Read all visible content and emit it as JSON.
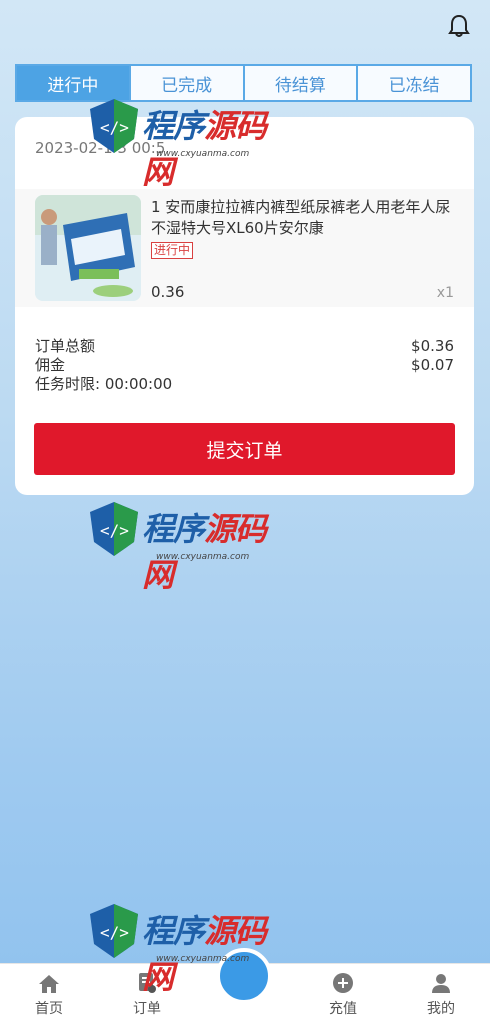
{
  "tabs": [
    {
      "label": "进行中"
    },
    {
      "label": "已完成"
    },
    {
      "label": "待结算"
    },
    {
      "label": "已冻结"
    }
  ],
  "order": {
    "time": "2023-02-1 3 00:5",
    "product_title": "1 安而康拉拉裤内裤型纸尿裤老人用老年人尿不湿特大号XL60片安尔康",
    "status": "进行中",
    "price": "0.36",
    "quantity": "x1"
  },
  "summary": {
    "total_label": "订单总额",
    "total_value": "$0.36",
    "commission_label": "佣金",
    "commission_value": "$0.07",
    "time_limit_label": "任务时限: 00:00:00"
  },
  "submit_label": "提交订单",
  "watermark": {
    "text_blue": "程序",
    "text_red": "源码网",
    "url": "www.cxyuanma.com"
  },
  "nav": [
    {
      "label": "首页",
      "icon": "home-icon"
    },
    {
      "label": "订单",
      "icon": "order-icon"
    },
    {
      "label": "充值",
      "icon": "plus-circle-icon"
    },
    {
      "label": "我的",
      "icon": "user-icon"
    }
  ]
}
